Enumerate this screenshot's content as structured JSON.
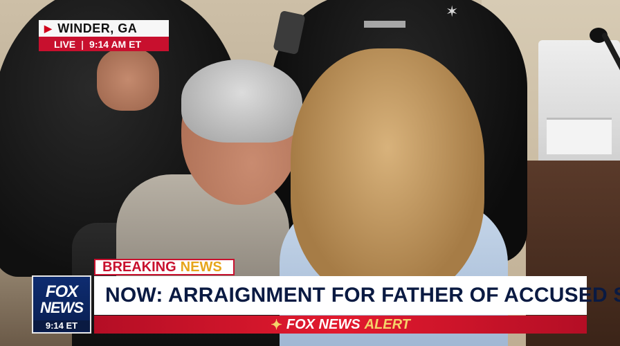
{
  "location_bug": {
    "location": "WINDER, GA",
    "live_label": "LIVE",
    "time": "9:14 AM ET"
  },
  "network_logo": {
    "line1": "FOX",
    "line2": "NEWS",
    "time": "9:14 ET"
  },
  "breaking_banner": {
    "word1": "BREAKING",
    "word2": "NEWS"
  },
  "headline": "NOW: ARRAIGNMENT FOR FATHER OF ACCUSED SHOOTER",
  "alert_bar": {
    "brand": "FOX NEWS",
    "label": "ALERT"
  },
  "colors": {
    "fox_red": "#c8102e",
    "fox_navy": "#0a1a42",
    "breaking_yellow": "#e7a51b"
  }
}
